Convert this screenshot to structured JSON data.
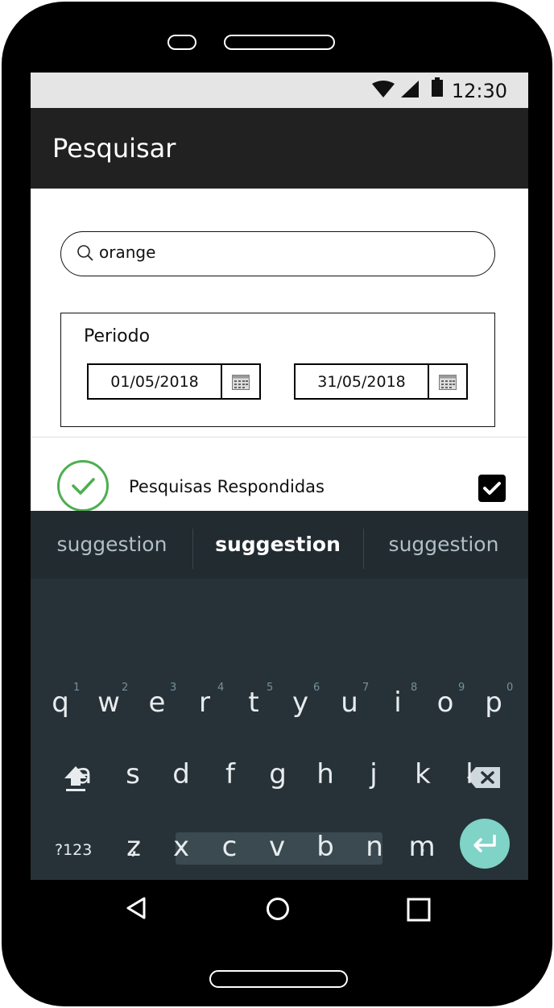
{
  "status_bar": {
    "time": "12:30",
    "icons": [
      "wifi-icon",
      "signal-icon",
      "battery-icon"
    ]
  },
  "app_bar": {
    "title": "Pesquisar"
  },
  "search": {
    "value": "orange"
  },
  "period": {
    "label": "Periodo",
    "start_date": "01/05/2018",
    "end_date": "31/05/2018"
  },
  "survey_row": {
    "label": "Pesquisas Respondidas",
    "checked": true
  },
  "keyboard": {
    "suggestions": [
      "suggestion",
      "suggestion",
      "suggestion"
    ],
    "row1": [
      "q",
      "w",
      "e",
      "r",
      "t",
      "y",
      "u",
      "i",
      "o",
      "p"
    ],
    "row1_hints": [
      "1",
      "2",
      "3",
      "4",
      "5",
      "6",
      "7",
      "8",
      "9",
      "0"
    ],
    "row2": [
      "a",
      "s",
      "d",
      "f",
      "g",
      "h",
      "j",
      "k",
      "l"
    ],
    "row3": [
      "z",
      "x",
      "c",
      "v",
      "b",
      "n",
      "m"
    ],
    "symbols_label": "?123",
    "comma": ",",
    "period_key": "."
  },
  "colors": {
    "app_bar": "#212121",
    "accent_green": "#4caf50",
    "keyboard_bg": "#263238",
    "enter_button": "#7fd3c7"
  }
}
